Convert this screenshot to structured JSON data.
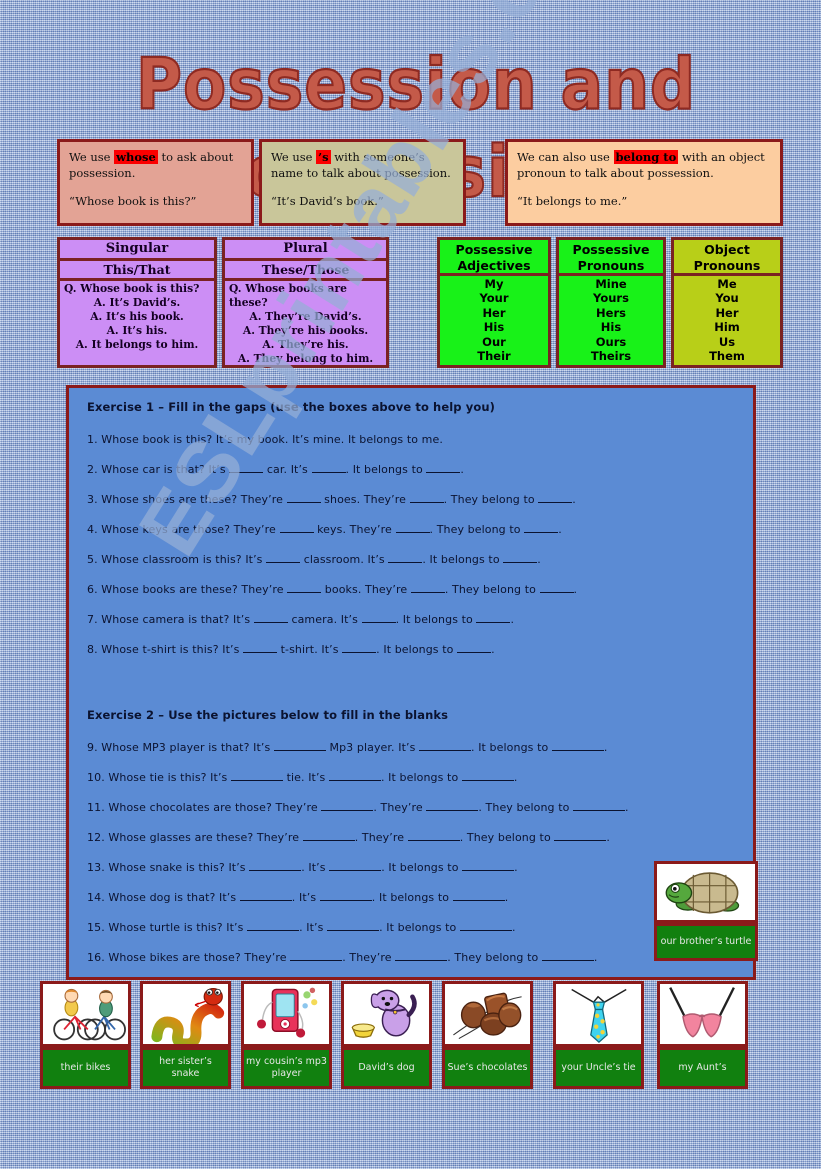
{
  "title": "Possession and Possessives",
  "watermark": "ESLprintables.com",
  "colors": {
    "background": "#92addb",
    "panel": "#5b8bd4",
    "border_dark_red": "#8b1a1a",
    "highlight_red": "#fb0000",
    "purple_table": "#cc8ef5",
    "green_table": "#18f218",
    "object_pronouns_table": "#b8cf18",
    "label_green": "#11800f",
    "title_fill": "#c45a49",
    "info_box_1": "#e3a395",
    "info_box_2": "#c9c69a",
    "info_box_3": "#fccda0"
  },
  "info_boxes": [
    {
      "pre": "We use ",
      "keyword": "whose",
      "post": " to ask about possession.",
      "quote": "“Whose book is this?”"
    },
    {
      "pre": "We use ",
      "keyword": "’s",
      "post": " with someone’s name to talk about possession.",
      "quote": "“It’s David’s book.”"
    },
    {
      "pre": "We can also use ",
      "keyword": "belong to",
      "post": " with an object pronoun to talk about possession.",
      "quote": "“It belongs to me.”"
    }
  ],
  "number_tables": [
    {
      "header": "Singular",
      "sub": "This/That",
      "rows": [
        "Q. Whose book is this?",
        "A. It’s David’s.",
        "A. It’s his book.",
        "A. It’s his.",
        "A. It belongs to him."
      ]
    },
    {
      "header": "Plural",
      "sub": "These/Those",
      "rows": [
        "Q. Whose books are these?",
        "A. They’re David’s.",
        "A. They’re his books.",
        "A. They’re his.",
        "A. They belong to him."
      ]
    }
  ],
  "pronoun_tables": [
    {
      "header_line1": "Possessive",
      "header_line2": "Adjectives",
      "items": [
        "My",
        "Your",
        "Her",
        "His",
        "Our",
        "Their"
      ]
    },
    {
      "header_line1": "Possessive",
      "header_line2": "Pronouns",
      "items": [
        "Mine",
        "Yours",
        "Hers",
        "His",
        "Ours",
        "Theirs"
      ]
    },
    {
      "header_line1": "Object",
      "header_line2": "Pronouns",
      "items": [
        "Me",
        "You",
        "Her",
        "Him",
        "Us",
        "Them"
      ]
    }
  ],
  "exercise1": {
    "heading": "Exercise 1 – Fill in the gaps (use the boxes above to help you)",
    "items": [
      "1. Whose book is this? It’s my book. It’s mine. It belongs to me.",
      "2. Whose car is that? It’s ____ car. It’s ____. It belongs to ____.",
      "3. Whose shoes are these? They’re ____ shoes. They’re ____. They belong to ____.",
      "4. Whose keys are those? They’re ____ keys. They’re ____. They belong to ____.",
      "5. Whose classroom is this? It’s ____ classroom. It’s ____. It belongs to ____.",
      "6. Whose books are these? They’re ____ books. They’re ____. They belong to ____.",
      "7. Whose camera is that? It’s ____ camera. It’s ____. It belongs to ____.",
      "8. Whose t-shirt is this? It’s ____ t-shirt. It’s ____. It belongs to ____."
    ]
  },
  "exercise2": {
    "heading": "Exercise 2 – Use the pictures below to fill in the blanks",
    "items": [
      "9. Whose MP3 player is that? It’s ______ Mp3 player. It’s ______. It belongs to ______.",
      "10. Whose tie is this? It’s ______ tie. It’s ______. It belongs to ______.",
      "11. Whose chocolates are those? They’re ______. They’re ______. They belong to ______.",
      "12. Whose glasses are these? They’re ______. They’re ______. They belong to ______.",
      "13. Whose snake is this? It’s ______. It’s ______. It belongs to ______.",
      "14. Whose dog is that? It’s ______. It’s ______. It belongs to ______.",
      "15. Whose turtle is this? It’s ______. It’s ______. It belongs to ______.",
      "16. Whose bikes are those? They’re ______. They’re ______. They belong to ______."
    ]
  },
  "picture_cards": [
    {
      "id": "bikes",
      "label": "their bikes"
    },
    {
      "id": "snake",
      "label": "her sister’s snake"
    },
    {
      "id": "mp3",
      "label": "my cousin’s mp3 player"
    },
    {
      "id": "dog",
      "label": "David’s dog"
    },
    {
      "id": "chocolates",
      "label": "Sue’s chocolates"
    },
    {
      "id": "tie",
      "label": "your Uncle’s tie"
    },
    {
      "id": "glasses",
      "label": "my Aunt’s"
    }
  ],
  "turtle_card": {
    "id": "turtle",
    "label": "our brother’s turtle"
  }
}
